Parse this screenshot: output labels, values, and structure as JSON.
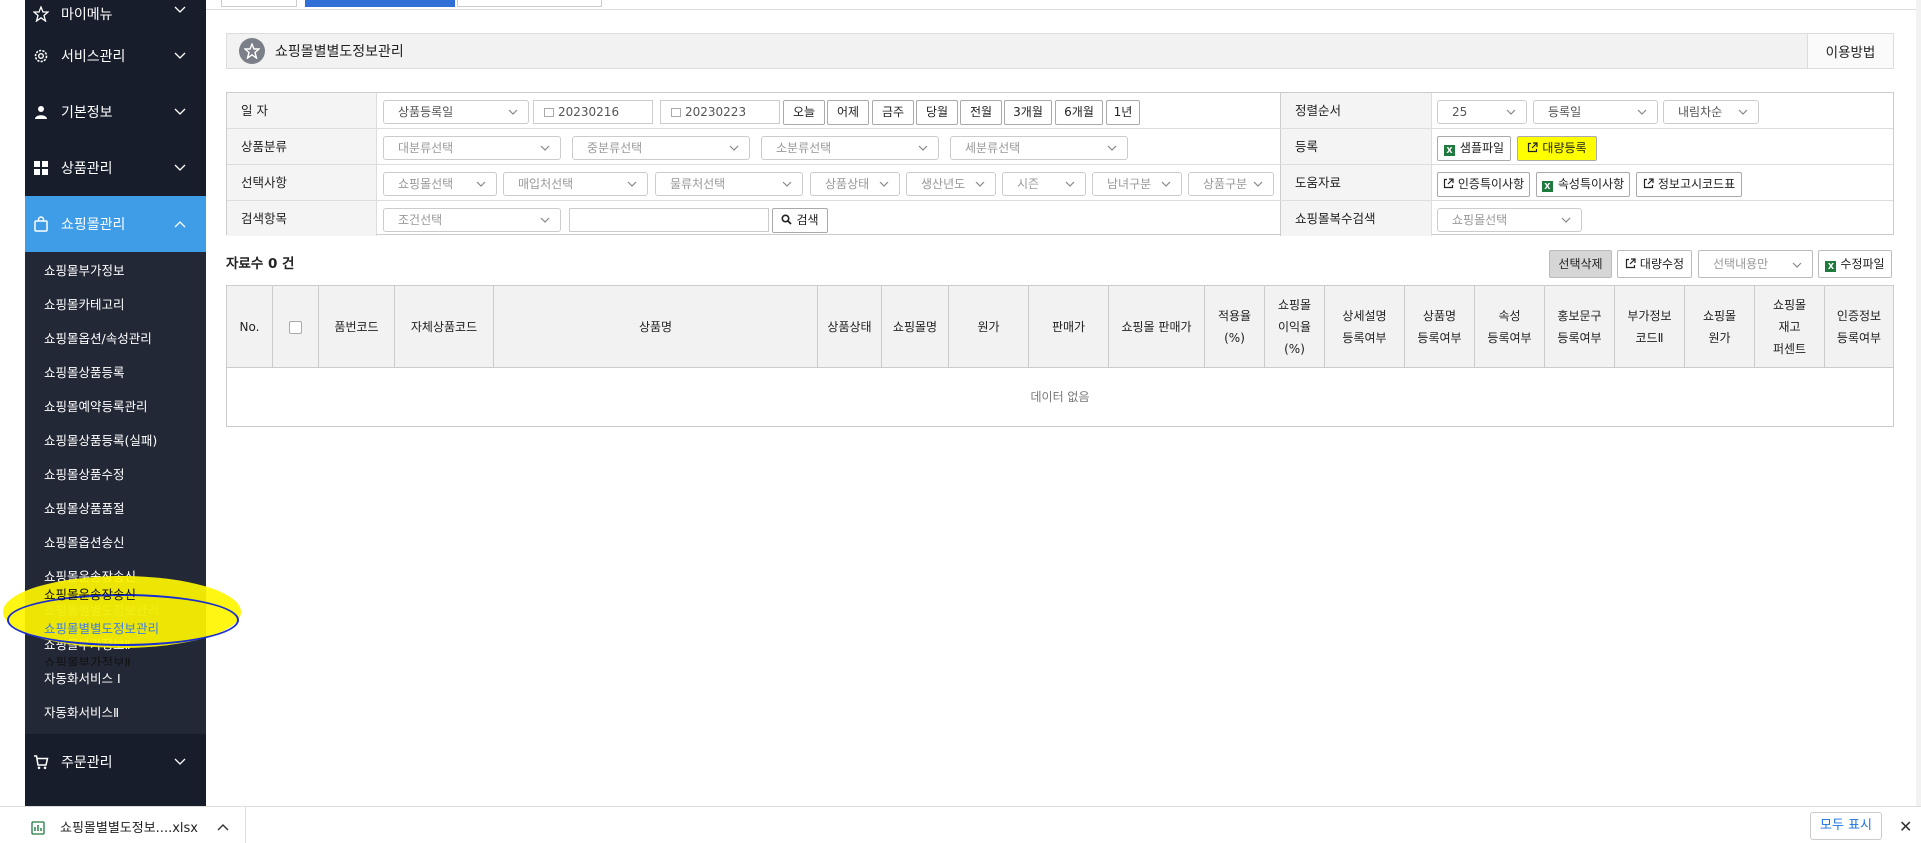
{
  "sidebar": {
    "top_items": [
      {
        "label": "마이메뉴",
        "icon": "star-icon"
      },
      {
        "label": "서비스관리",
        "icon": "gear-icon"
      },
      {
        "label": "기본정보",
        "icon": "user-icon"
      },
      {
        "label": "상품관리",
        "icon": "grid-icon"
      },
      {
        "label": "쇼핑몰관리",
        "icon": "bag-icon"
      }
    ],
    "sub_items": [
      "쇼핑몰부가정보",
      "쇼핑몰카테고리",
      "쇼핑몰옵션/속성관리",
      "쇼핑몰상품등록",
      "쇼핑몰예약등록관리",
      "쇼핑몰상품등록(실패)",
      "쇼핑몰상품수정",
      "쇼핑몰상품품절",
      "쇼핑몰옵션송신",
      "쇼핑몰운송장송신",
      "쇼핑몰별별도정보관리",
      "쇼핑몰부가정보Ⅱ",
      "자동화서비스 Ⅰ",
      "자동화서비스Ⅱ"
    ],
    "bottom_item": {
      "label": "주문관리",
      "icon": "cart-icon"
    },
    "active_color": "#3f9de8"
  },
  "header": {
    "title": "쇼핑몰별별도정보관리",
    "help": "이용방법"
  },
  "filters": {
    "date": {
      "label": "일 자",
      "type_select": "상품등록일",
      "start": "20230216",
      "end": "20230223",
      "quick": [
        "오늘",
        "어제",
        "금주",
        "당월",
        "전월",
        "3개월",
        "6개월",
        "1년"
      ]
    },
    "category": {
      "label": "상품분류",
      "selects": [
        "대분류선택",
        "중분류선택",
        "소분류선택",
        "세분류선택"
      ]
    },
    "options": {
      "label": "선택사항",
      "selects": [
        "쇼핑몰선택",
        "매입처선택",
        "물류처선택",
        "상품상태",
        "생산년도",
        "시즌",
        "남녀구분",
        "상품구분"
      ]
    },
    "search": {
      "label": "검색항목",
      "condition": "조건선택",
      "button": "검색"
    },
    "sort": {
      "label": "정렬순서",
      "count": "25",
      "field": "등록일",
      "order": "내림차순"
    },
    "register": {
      "label": "등록",
      "sample": "샘플파일",
      "bulk": "대량등록"
    },
    "help": {
      "label": "도움자료",
      "buttons": [
        "인증특이사항",
        "속성특이사항",
        "정보고시코드표"
      ]
    },
    "mall_search": {
      "label": "쇼핑몰복수검색",
      "select": "쇼핑몰선택"
    }
  },
  "results": {
    "count_label": "자료수 0 건",
    "toolbar": {
      "delete": "선택삭제",
      "bulk_edit": "대량수정",
      "select_only": "선택내용만",
      "edit_file": "수정파일"
    },
    "columns": [
      "No.",
      "",
      "품번코드",
      "자체상품코드",
      "상품명",
      "상품상태",
      "쇼핑몰명",
      "원가",
      "판매가",
      "쇼핑몰 판매가",
      "적용율\n(%)",
      "쇼핑몰\n이익율\n(%)",
      "상세설명\n등록여부",
      "상품명\n등록여부",
      "속성\n등록여부",
      "홍보문구\n등록여부",
      "부가정보\n코드Ⅱ",
      "쇼핑몰\n원가",
      "쇼핑몰\n재고\n퍼센트",
      "인증정보\n등록여부"
    ],
    "empty": "데이터 없음"
  },
  "download_bar": {
    "file": "쇼핑몰별별도정보....xlsx",
    "show_all": "모두 표시"
  }
}
